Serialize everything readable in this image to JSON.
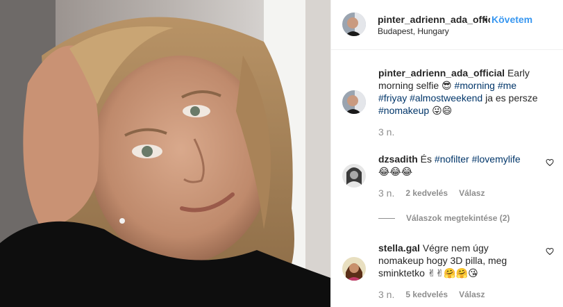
{
  "post": {
    "image_alt": "Early morning selfie",
    "author": {
      "username": "pinter_adrienn_ada_official",
      "location": "Budapest, Hungary",
      "follow_label": "Követem",
      "separator": "•"
    },
    "caption": {
      "username": "pinter_adrienn_ada_official",
      "text_before": "Early morning selfie",
      "emoji_1": "😎",
      "tag_morning": "#morning",
      "tag_me": "#me",
      "tag_friyay": "#friyay",
      "tag_almostweekend": "#almostweekend",
      "text_middle": "ja es persze",
      "tag_nomakeup": "#nomakeup",
      "emoji_end": "😜😄",
      "time": "3 n."
    },
    "comments": [
      {
        "username": "dzsadith",
        "text": "És",
        "tag_nofilter": "#nofilter",
        "tag_lovemylife": "#lovemylife",
        "emojis": "😂😂😂",
        "time": "3 n.",
        "likes": "2 kedvelés",
        "reply_label": "Válasz",
        "view_replies": "Válaszok megtekintése (2)"
      },
      {
        "username": "stella.gal",
        "text": "Végre nem úgy nomakeup hogy 3D pilla, meg sminktetko",
        "emojis": "✌✌🤗🤗😘",
        "time": "3 n.",
        "likes": "5 kedvelés",
        "reply_label": "Válasz"
      }
    ]
  },
  "colors": {
    "link": "#3897f0",
    "hashtag": "#003569",
    "muted": "#8e8e8e",
    "text": "#262626",
    "divider": "#efefef"
  },
  "icons": [
    "heart-outline-icon"
  ]
}
